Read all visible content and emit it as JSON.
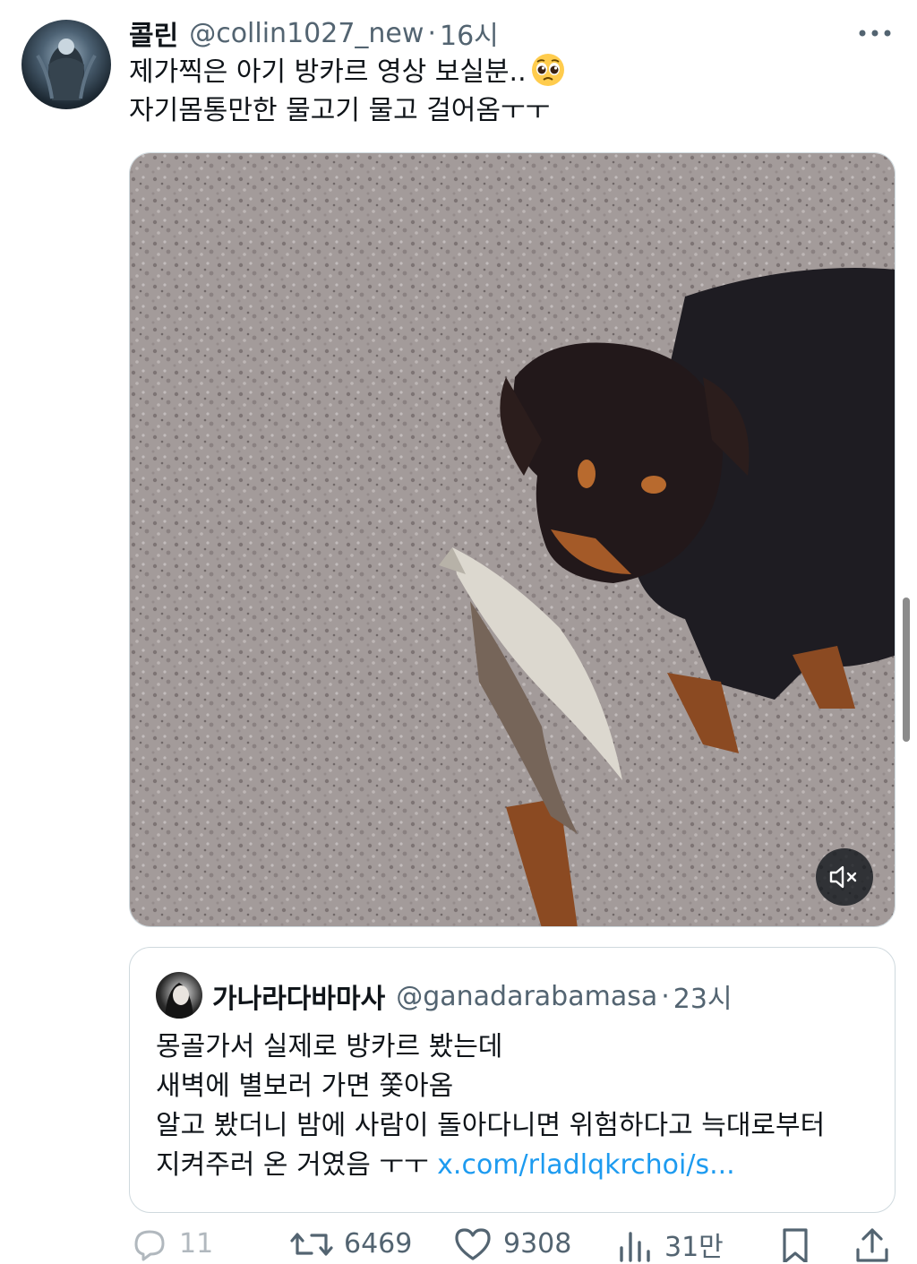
{
  "tweet": {
    "display_name": "콜린",
    "handle": "@collin1027_new",
    "separator": "·",
    "time": "16시",
    "line1": "제가찍은 아기 방카르 영상 보실분..",
    "line1_emoji": "pleading-face",
    "line2": "자기몸통만한 물고기 물고 걸어옴ㅜㅜ",
    "media": {
      "description_icon": "video",
      "mute_icon": "speaker-muted-icon"
    }
  },
  "quote": {
    "display_name": "가나라다바마사",
    "handle": "@ganadarabamasa",
    "separator": "·",
    "time": "23시",
    "line1": "몽골가서 실제로 방카르 봤는데",
    "line2": "새벽에 별보러 가면 쫓아옴",
    "line3": "알고 봤더니 밤에 사람이 돌아다니면 위험하다고 늑대로부터",
    "line4_text": "지켜주러 온 거였음 ㅜㅜ ",
    "line4_link": "x.com/rladlqkrchoi/s..."
  },
  "actions": {
    "reply_count": "11",
    "retweet_count": "6469",
    "like_count": "9308",
    "views_count": "31만"
  },
  "colors": {
    "text": "#0f1419",
    "secondary": "#536471",
    "link": "#1d9bf0",
    "border": "#cfd9de"
  }
}
